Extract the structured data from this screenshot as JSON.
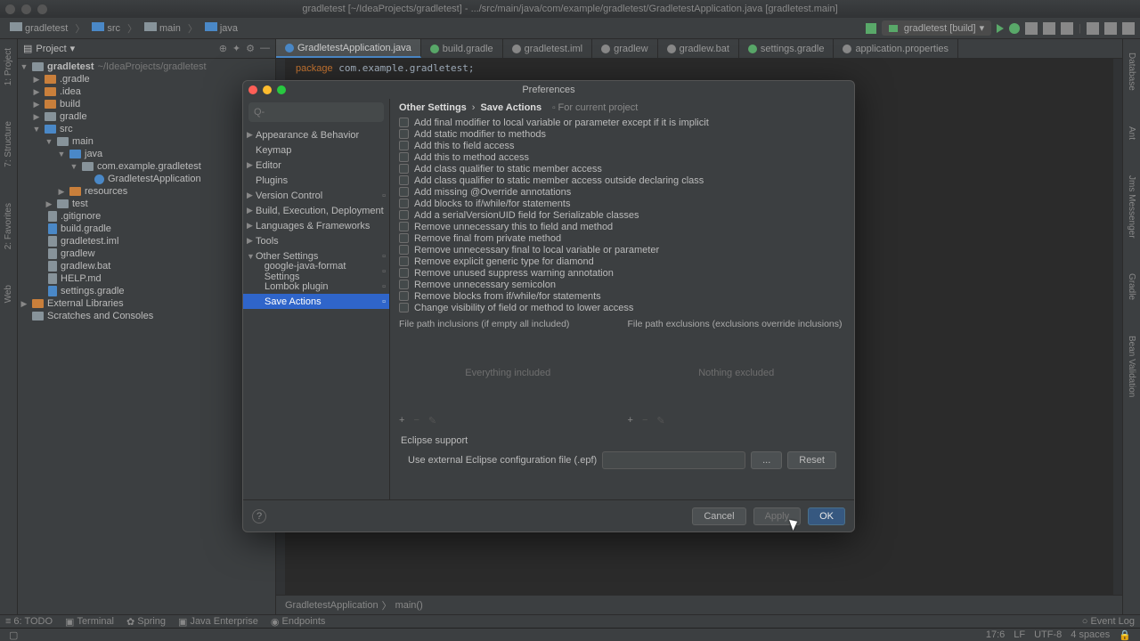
{
  "titlebar": "gradletest [~/IdeaProjects/gradletest] - .../src/main/java/com/example/gradletest/GradletestApplication.java [gradletest.main]",
  "breadcrumbs": [
    "gradletest",
    "src",
    "main",
    "java"
  ],
  "run_config": "gradletest [build]",
  "project_header": "Project",
  "tree": {
    "root": "gradletest",
    "root_hint": "~/IdeaProjects/gradletest",
    "items": [
      ".gradle",
      ".idea",
      "build",
      "gradle",
      "src",
      "main",
      "java",
      "com.example.gradletest",
      "GradletestApplication",
      "resources",
      "test",
      ".gitignore",
      "build.gradle",
      "gradletest.iml",
      "gradlew",
      "gradlew.bat",
      "HELP.md",
      "settings.gradle"
    ],
    "ext1": "External Libraries",
    "ext2": "Scratches and Consoles"
  },
  "tabs": [
    "GradletestApplication.java",
    "build.gradle",
    "gradletest.iml",
    "gradlew",
    "gradlew.bat",
    "settings.gradle",
    "application.properties"
  ],
  "code_line": "package com.example.gradletest;",
  "editor_crumb1": "GradletestApplication",
  "editor_crumb2": "main()",
  "bottom_tools": [
    "6: TODO",
    "Terminal",
    "Spring",
    "Java Enterprise",
    "Endpoints"
  ],
  "bottom_right": "Event Log",
  "status": {
    "pos": "17:6",
    "lf": "LF",
    "enc": "UTF-8",
    "indent": "4 spaces"
  },
  "left_tools": [
    "1: Project",
    "7: Structure",
    "2: Favorites",
    "Web"
  ],
  "right_tools": [
    "Database",
    "Ant",
    "Jms Messenger",
    "Gradle",
    "Bean Validation"
  ],
  "modal": {
    "title": "Preferences",
    "search_ph": "Q-",
    "side": [
      "Appearance & Behavior",
      "Keymap",
      "Editor",
      "Plugins",
      "Version Control",
      "Build, Execution, Deployment",
      "Languages & Frameworks",
      "Tools",
      "Other Settings"
    ],
    "side_sub": [
      "google-java-format Settings",
      "Lombok plugin",
      "Save Actions"
    ],
    "crumb1": "Other Settings",
    "crumb2": "Save Actions",
    "crumb_proj": "For current project",
    "options": [
      "Add final modifier to local variable or parameter except if it is implicit",
      "Add static modifier to methods",
      "Add this to field access",
      "Add this to method access",
      "Add class qualifier to static member access",
      "Add class qualifier to static member access outside declaring class",
      "Add missing @Override annotations",
      "Add blocks to if/while/for statements",
      "Add a serialVersionUID field for Serializable classes",
      "Remove unnecessary this to field and method",
      "Remove final from private method",
      "Remove unnecessary final to local variable or parameter",
      "Remove explicit generic type for diamond",
      "Remove unused suppress warning annotation",
      "Remove unnecessary semicolon",
      "Remove blocks from if/while/for statements",
      "Change visibility of field or method to lower access"
    ],
    "path_inc_label": "File path inclusions (if empty all included)",
    "path_exc_label": "File path exclusions (exclusions override inclusions)",
    "path_inc_ph": "Everything included",
    "path_exc_ph": "Nothing excluded",
    "eclipse_hdr": "Eclipse support",
    "eclipse_lbl": "Use external Eclipse configuration file (.epf)",
    "browse": "...",
    "reset": "Reset",
    "cancel": "Cancel",
    "apply": "Apply",
    "ok": "OK"
  }
}
